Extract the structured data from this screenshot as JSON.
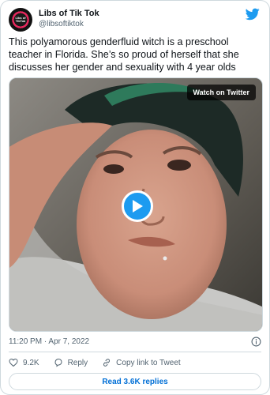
{
  "author": {
    "name": "Libs of Tik Tok",
    "handle": "@libsoftiktok",
    "avatar_text": "Libs of TikTok"
  },
  "icons": {
    "brand": "twitter-bird-icon",
    "play": "play-icon",
    "info": "info-icon",
    "like": "heart-icon",
    "reply": "reply-icon",
    "copy_link": "link-icon"
  },
  "tweet": {
    "text": "This polyamorous genderfluid witch is a preschool teacher in Florida. She’s so proud of herself that she discusses her gender and sexuality with 4 year olds",
    "timestamp": "11:20 PM · Apr 7, 2022"
  },
  "media": {
    "watch_label": "Watch on Twitter"
  },
  "actions": {
    "like_count": "9.2K",
    "reply_label": "Reply",
    "copy_link_label": "Copy link to Tweet"
  },
  "footer": {
    "read_replies_label": "Read 3.6K replies"
  },
  "colors": {
    "accent": "#1d9bf0",
    "link": "#006fd6",
    "muted": "#536471",
    "border": "#cfd9de"
  }
}
